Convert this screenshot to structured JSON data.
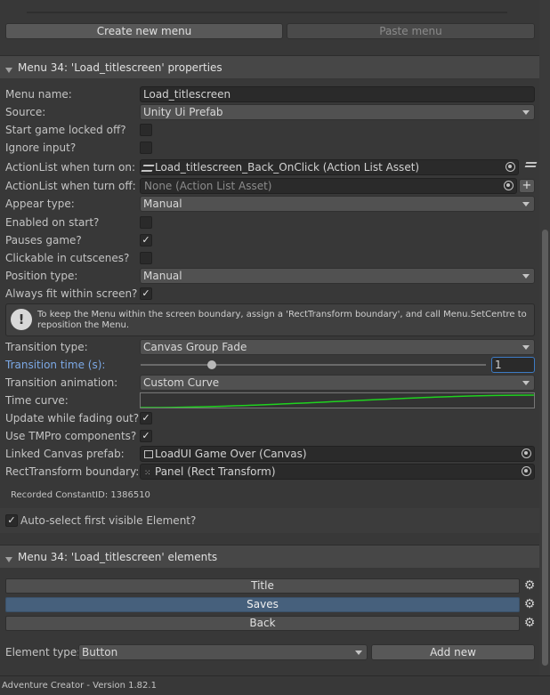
{
  "toolbar": {
    "create_label": "Create new menu",
    "paste_label": "Paste menu"
  },
  "properties": {
    "header": "Menu 34: 'Load_titlescreen' properties",
    "menu_name_label": "Menu name:",
    "menu_name_value": "Load_titlescreen",
    "source_label": "Source:",
    "source_value": "Unity Ui Prefab",
    "start_locked_label": "Start game locked off?",
    "start_locked_checked": "",
    "ignore_input_label": "Ignore input?",
    "ignore_input_checked": "",
    "al_on_label": "ActionList when turn on:",
    "al_on_value": "Load_titlescreen_Back_OnClick (Action List Asset)",
    "al_off_label": "ActionList when turn off:",
    "al_off_value": "None (Action List Asset)",
    "appear_label": "Appear type:",
    "appear_value": "Manual",
    "enabled_label": "Enabled on start?",
    "enabled_checked": "",
    "pauses_label": "Pauses game?",
    "pauses_checked": "✓",
    "clickable_label": "Clickable in cutscenes?",
    "clickable_checked": "",
    "position_label": "Position type:",
    "position_value": "Manual",
    "fit_label": "Always fit within screen?",
    "fit_checked": "✓",
    "info_text": "To keep the Menu within the screen boundary, assign a 'RectTransform boundary', and call Menu.SetCentre to reposition the Menu.",
    "transition_type_label": "Transition type:",
    "transition_type_value": "Canvas Group Fade",
    "transition_time_label": "Transition time (s):",
    "transition_time_value": "1",
    "transition_anim_label": "Transition animation:",
    "transition_anim_value": "Custom Curve",
    "time_curve_label": "Time curve:",
    "update_fading_label": "Update while fading out?",
    "update_fading_checked": "✓",
    "tmpro_label": "Use TMPro components?",
    "tmpro_checked": "✓",
    "linked_canvas_label": "Linked Canvas prefab:",
    "linked_canvas_value": "LoadUI Game Over (Canvas)",
    "rect_boundary_label": "RectTransform boundary:",
    "rect_boundary_value": "Panel (Rect Transform)",
    "constant_id": "Recorded ConstantID: 1386510",
    "auto_select_label": "Auto-select first visible Element?",
    "auto_select_checked": "✓"
  },
  "elements": {
    "header": "Menu 34: 'Load_titlescreen' elements",
    "items": [
      {
        "label": "Title"
      },
      {
        "label": "Saves"
      },
      {
        "label": "Back"
      }
    ],
    "element_type_label": "Element type:",
    "element_type_value": "Button",
    "add_new_label": "Add new"
  },
  "footer": {
    "version": "Adventure Creator - Version 1.82.1"
  }
}
